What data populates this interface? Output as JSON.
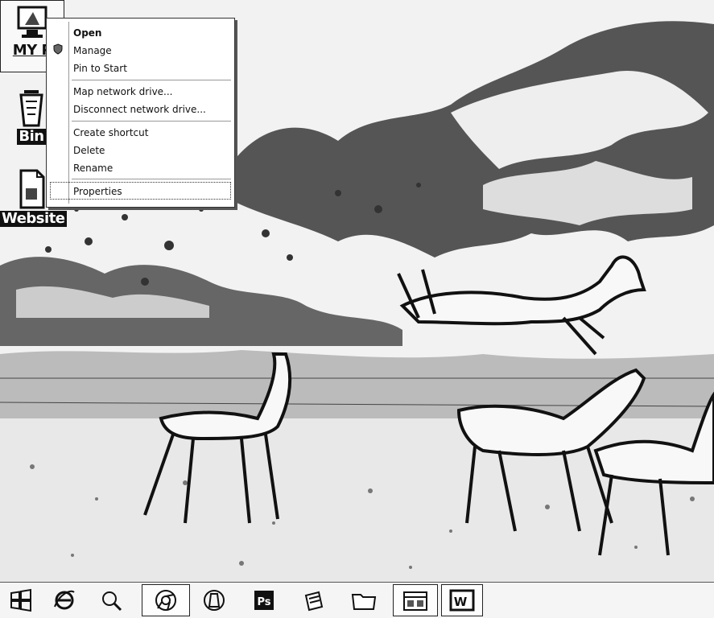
{
  "desktop": {
    "icons": [
      {
        "name": "my-pc",
        "label": "MY P",
        "icon": "computer-icon",
        "selected": true
      },
      {
        "name": "recycle-bin",
        "label": "Bin",
        "icon": "recycle-bin-icon",
        "selected": false
      },
      {
        "name": "website",
        "label": "Website",
        "icon": "document-icon",
        "selected": false
      }
    ]
  },
  "context_menu": {
    "items": [
      {
        "label": "Open",
        "bold": true
      },
      {
        "label": "Manage",
        "icon": "uac-shield-icon"
      },
      {
        "label": "Pin to Start"
      },
      {
        "label": "Map network drive..."
      },
      {
        "label": "Disconnect network drive..."
      },
      {
        "label": "Create shortcut"
      },
      {
        "label": "Delete"
      },
      {
        "label": "Rename"
      },
      {
        "label": "Properties",
        "highlighted": true
      }
    ]
  },
  "taskbar": {
    "buttons": [
      {
        "icon": "windows-start-icon",
        "active": false
      },
      {
        "icon": "internet-explorer-icon",
        "active": false
      },
      {
        "icon": "search-magnifier-icon",
        "active": false
      },
      {
        "icon": "chrome-icon",
        "active": true
      },
      {
        "icon": "vlc-icon",
        "active": false
      },
      {
        "icon": "photoshop-icon",
        "label": "Ps",
        "active": false
      },
      {
        "icon": "notes-icon",
        "active": false
      },
      {
        "icon": "folder-icon",
        "active": false
      },
      {
        "icon": "file-explorer-icon",
        "active": true
      },
      {
        "icon": "word-icon",
        "label": "W",
        "active": true
      }
    ]
  },
  "colors": {
    "menu_background": "#ffffff",
    "menu_border": "#333333",
    "icon_caption_background": "#111111",
    "icon_caption_text": "#ffffff"
  }
}
